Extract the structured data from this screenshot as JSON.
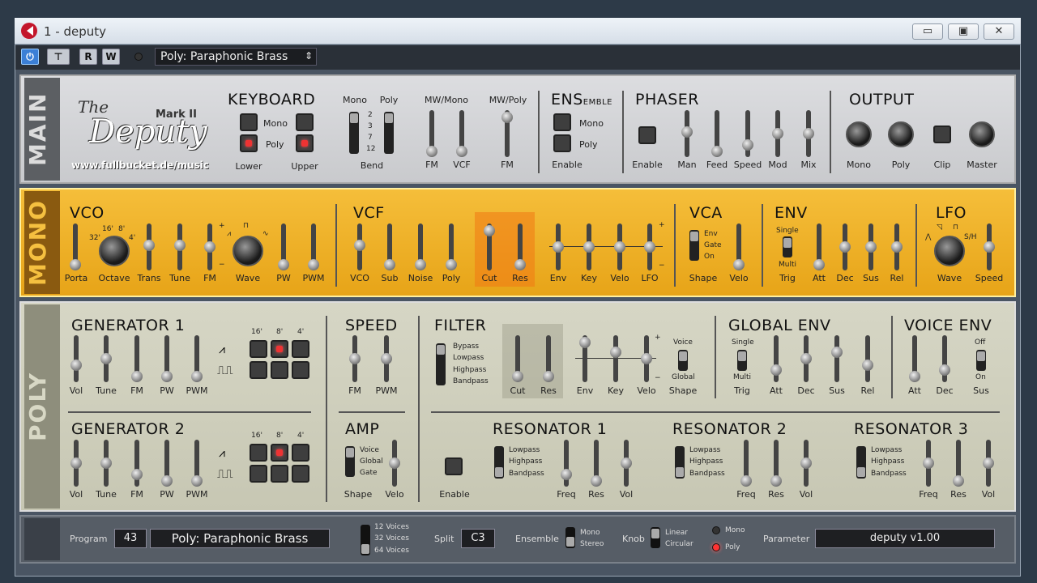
{
  "window": {
    "title": "1 - deputy",
    "min": "▭",
    "max": "▣",
    "close": "✕"
  },
  "toolbar": {
    "power": "⏻",
    "instr": "⊤",
    "read": "R",
    "write": "W",
    "preset": "Poly: Paraphonic Brass",
    "arrows": "⇕"
  },
  "logo": {
    "the": "The",
    "mark": "Mark II",
    "name": "Deputy",
    "url": "www.fullbucket.de/music"
  },
  "main": {
    "side": "MAIN",
    "keyboard": {
      "title": "KEYBOARD",
      "mono": "Mono",
      "poly": "Poly",
      "lower": "Lower",
      "upper": "Upper"
    },
    "bend": {
      "mono": "Mono",
      "poly": "Poly",
      "vals": [
        "2",
        "3",
        "7",
        "12"
      ],
      "label": "Bend"
    },
    "mw": {
      "mwmono": "MW/Mono",
      "mwpoly": "MW/Poly",
      "fm": "FM",
      "vcf": "VCF",
      "fm2": "FM"
    },
    "ens": {
      "title": "ENS",
      "sub": "EMBLE",
      "mono": "Mono",
      "poly": "Poly",
      "enable": "Enable"
    },
    "phaser": {
      "title": "PHASER",
      "labels": [
        "Enable",
        "Man",
        "Feed",
        "Speed",
        "Mod",
        "Mix"
      ]
    },
    "output": {
      "title": "OUTPUT",
      "labels": [
        "Mono",
        "Poly",
        "Clip",
        "Master"
      ]
    }
  },
  "mono": {
    "side": "MONO",
    "vco": {
      "title": "VCO",
      "labels": [
        "Porta",
        "Octave",
        "Trans",
        "Tune",
        "FM",
        "Wave",
        "PW",
        "PWM"
      ],
      "oct": [
        "32'",
        "16'",
        "8'",
        "4'"
      ],
      "plus": "+",
      "minus": "−"
    },
    "vcf": {
      "title": "VCF",
      "labels": [
        "VCO",
        "Sub",
        "Noise",
        "Poly",
        "Cut",
        "Res",
        "Env",
        "Key",
        "Velo",
        "LFO"
      ],
      "plus": "+",
      "minus": "−"
    },
    "vca": {
      "title": "VCA",
      "opts": [
        "Env",
        "Gate",
        "On"
      ],
      "labels": [
        "Shape",
        "Velo"
      ]
    },
    "env": {
      "title": "ENV",
      "single": "Single",
      "multi": "Multi",
      "labels": [
        "Trig",
        "Att",
        "Dec",
        "Sus",
        "Rel"
      ]
    },
    "lfo": {
      "title": "LFO",
      "sh": "S/H",
      "labels": [
        "Wave",
        "Speed"
      ]
    }
  },
  "poly": {
    "side": "POLY",
    "gen1": {
      "title": "GENERATOR 1",
      "labels": [
        "Vol",
        "Tune",
        "FM",
        "PW",
        "PWM"
      ],
      "feet": [
        "16'",
        "8'",
        "4'"
      ]
    },
    "gen2": {
      "title": "GENERATOR 2",
      "labels": [
        "Vol",
        "Tune",
        "FM",
        "PW",
        "PWM"
      ],
      "feet": [
        "16'",
        "8'",
        "4'"
      ]
    },
    "speed": {
      "title": "SPEED",
      "labels": [
        "FM",
        "PWM"
      ]
    },
    "amp": {
      "title": "AMP",
      "opts": [
        "Voice",
        "Global",
        "Gate"
      ],
      "labels": [
        "Shape",
        "Velo"
      ]
    },
    "filter": {
      "title": "FILTER",
      "opts": [
        "Bypass",
        "Lowpass",
        "Highpass",
        "Bandpass"
      ],
      "labels": [
        "Cut",
        "Res",
        "Env",
        "Key",
        "Velo",
        "Shape"
      ],
      "voice": "Voice",
      "global": "Global",
      "plus": "+",
      "minus": "−"
    },
    "genv": {
      "title": "GLOBAL ENV",
      "single": "Single",
      "multi": "Multi",
      "labels": [
        "Trig",
        "Att",
        "Dec",
        "Sus",
        "Rel"
      ]
    },
    "venv": {
      "title": "VOICE ENV",
      "off": "Off",
      "on": "On",
      "labels": [
        "Att",
        "Dec",
        "Sus"
      ]
    },
    "res1": {
      "title": "RESONATOR 1",
      "opts": [
        "Lowpass",
        "Highpass",
        "Bandpass"
      ],
      "labels": [
        "Freq",
        "Res",
        "Vol"
      ]
    },
    "res2": {
      "title": "RESONATOR 2",
      "opts": [
        "Lowpass",
        "Highpass",
        "Bandpass"
      ],
      "labels": [
        "Freq",
        "Res",
        "Vol"
      ]
    },
    "res3": {
      "title": "RESONATOR 3",
      "opts": [
        "Lowpass",
        "Highpass",
        "Bandpass"
      ],
      "labels": [
        "Freq",
        "Res",
        "Vol"
      ]
    },
    "enable": "Enable"
  },
  "bottom": {
    "program": "Program",
    "prognum": "43",
    "progname": "Poly: Paraphonic Brass",
    "voices": [
      "12 Voices",
      "32 Voices",
      "64 Voices"
    ],
    "split": "Split",
    "splitval": "C3",
    "ensemble": "Ensemble",
    "ensopts": [
      "Mono",
      "Stereo"
    ],
    "knob": "Knob",
    "knobopts": [
      "Linear",
      "Circular"
    ],
    "mono": "Mono",
    "poly": "Poly",
    "parameter": "Parameter",
    "paramval": "deputy v1.00"
  }
}
